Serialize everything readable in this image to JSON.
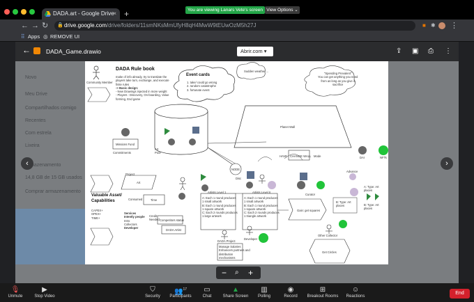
{
  "browser": {
    "tab_title": "DADA.art - Google Drive",
    "tab_close": "×",
    "new_tab": "+",
    "share_banner": "You are viewing Lanars Vete's screen",
    "view_options": "View Options ⌄",
    "url_host": "drive.google.com",
    "url_path": "/drive/folders/11smNKsMmUfyH8qH4MwW9tEUwOzM5h27J",
    "bookmarks": [
      "Apps",
      "REMOVE UI"
    ]
  },
  "viewer": {
    "file_title": "DADA_Game.drawio",
    "open_with": "Abrir.com ▾"
  },
  "drive_sidebar": [
    "Novo",
    "Meu Drive",
    "Compartilhados comigo",
    "Recentes",
    "Com estrela",
    "Lixeira",
    "Armazenamento",
    "14,8 GB de 15 GB usados",
    "Comprar armazenamento"
  ],
  "diagram": {
    "title": "DADA Rule book",
    "community_member": "Community Member",
    "rulebook_lines": [
      "make of info already, try to translate the",
      "players take turn, exchange, and execute",
      "finite rules",
      "",
      "-> Basic design:",
      "",
      "- New Drawings injected in more weight",
      "",
      "- Players : Discovery, On-boarding, Value",
      "  forming, End game"
    ],
    "event_cards_title": "Event cards",
    "event_cards_lines": [
      "1. take/ could go wrong",
      "2. random catastrophe",
      "3. fortunate event"
    ],
    "sudden_weather": "Sudden weather ...",
    "spending_prevalent": [
      "\"Spending Prevalent\"",
      "You can get anything you need",
      "from as long as you give it",
      "sacrifice"
    ],
    "planet_wall": "Planet Wall",
    "mission_fund": "Missions Fund",
    "commitments": "Commitments",
    "art_pool": "Art\nPool",
    "have": "HAVE",
    "change_wall": "CHANGE WALL",
    "mode": "Mode",
    "dai": "DAI",
    "nfts": "NFTs",
    "node": "NODE",
    "disc": "Disc",
    "valuable_assets": "Valuable Asset/\nCapabilities",
    "va_list": [
      "CAPEX+",
      "OPEX+",
      "TIME+"
    ],
    "project": "Project",
    "art": "Art",
    "consumed": "Consumed",
    "time": "Time",
    "services": [
      "Services",
      "Intently people",
      "Intro",
      "Collectors",
      "Developer"
    ],
    "credit_needed": "Credit\nNeeded",
    "competitors": "Competitors status",
    "dada_artist": "DADA Artist",
    "artists_level1": "Artists Level 1",
    "artists_level2": "Artists Level II",
    "level1_list": [
      "A: Each 1 round produces",
      "1 small artwork",
      "B: Each 1 round produces",
      "1 square artwork",
      "C: Each 2 rounds produces",
      "1 large artwork"
    ],
    "level2_list": [
      "A: Each 1 round produces",
      "1 small artwork",
      "B: Each 1 round produces",
      "1 square artwork",
      "C: Each 2 rounds produces",
      "1 triangle artwork"
    ],
    "curator": "Curator",
    "gain_new": "Gain: get squares",
    "other_collector": "Other Collector",
    "get_circles": "Get Circles",
    "advance": "Advance",
    "dada_project": "DADA Project",
    "dada_project_box": [
      "Manage Salaries",
      "Enhancers partners and",
      "distribution",
      "mechanisms"
    ],
    "developer": "Developer",
    "type_art1": "A: Type: Art\nplaces",
    "type_art2": "B: Type: Art\nplaces",
    "type_art3": "B: Type: Art\nplaces"
  },
  "zoom_controls": {
    "minus": "−",
    "search": "⌕",
    "plus": "+"
  },
  "page_nav": {
    "prev": "‹",
    "next": "›"
  },
  "meeting": {
    "unmute": "Unmute",
    "stop_video": "Stop Video",
    "security": "Security",
    "participants": "Participants",
    "participant_count": "17",
    "chat": "Chat",
    "share_screen": "Share Screen",
    "polling": "Polling",
    "record": "Record",
    "breakout": "Breakout Rooms",
    "reactions": "Reactions",
    "end": "End"
  },
  "colors": {
    "share_green": "#23a548",
    "end_red": "#d3212c",
    "node_green": "#21c43a",
    "node_blue": "#5b6e8c",
    "node_gray": "#666666",
    "node_purple": "#c9b7d6"
  }
}
